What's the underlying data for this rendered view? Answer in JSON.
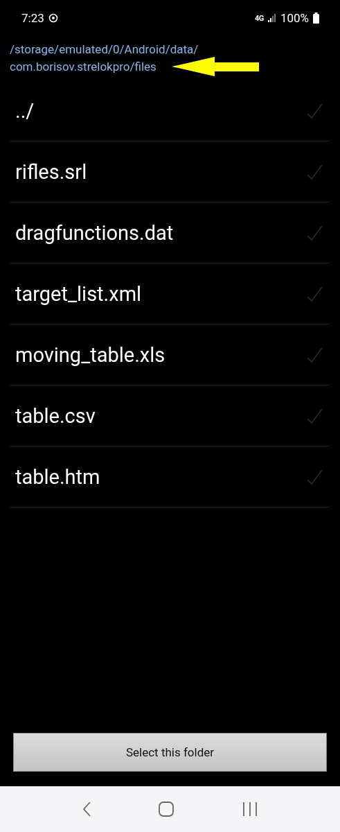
{
  "status_bar": {
    "time": "7:23",
    "network": "4G",
    "battery": "100%"
  },
  "path": {
    "lines": [
      "/storage/emulated/0/Android/data/",
      "com.borisov.strelokpro/files"
    ],
    "annotation_arrow": true
  },
  "files": [
    {
      "name": "../",
      "checked": false
    },
    {
      "name": "rifles.srl",
      "checked": false
    },
    {
      "name": "dragfunctions.dat",
      "checked": false
    },
    {
      "name": "target_list.xml",
      "checked": false
    },
    {
      "name": "moving_table.xls",
      "checked": false
    },
    {
      "name": "table.csv",
      "checked": false
    },
    {
      "name": "table.htm",
      "checked": false
    }
  ],
  "button": "Select this folder"
}
